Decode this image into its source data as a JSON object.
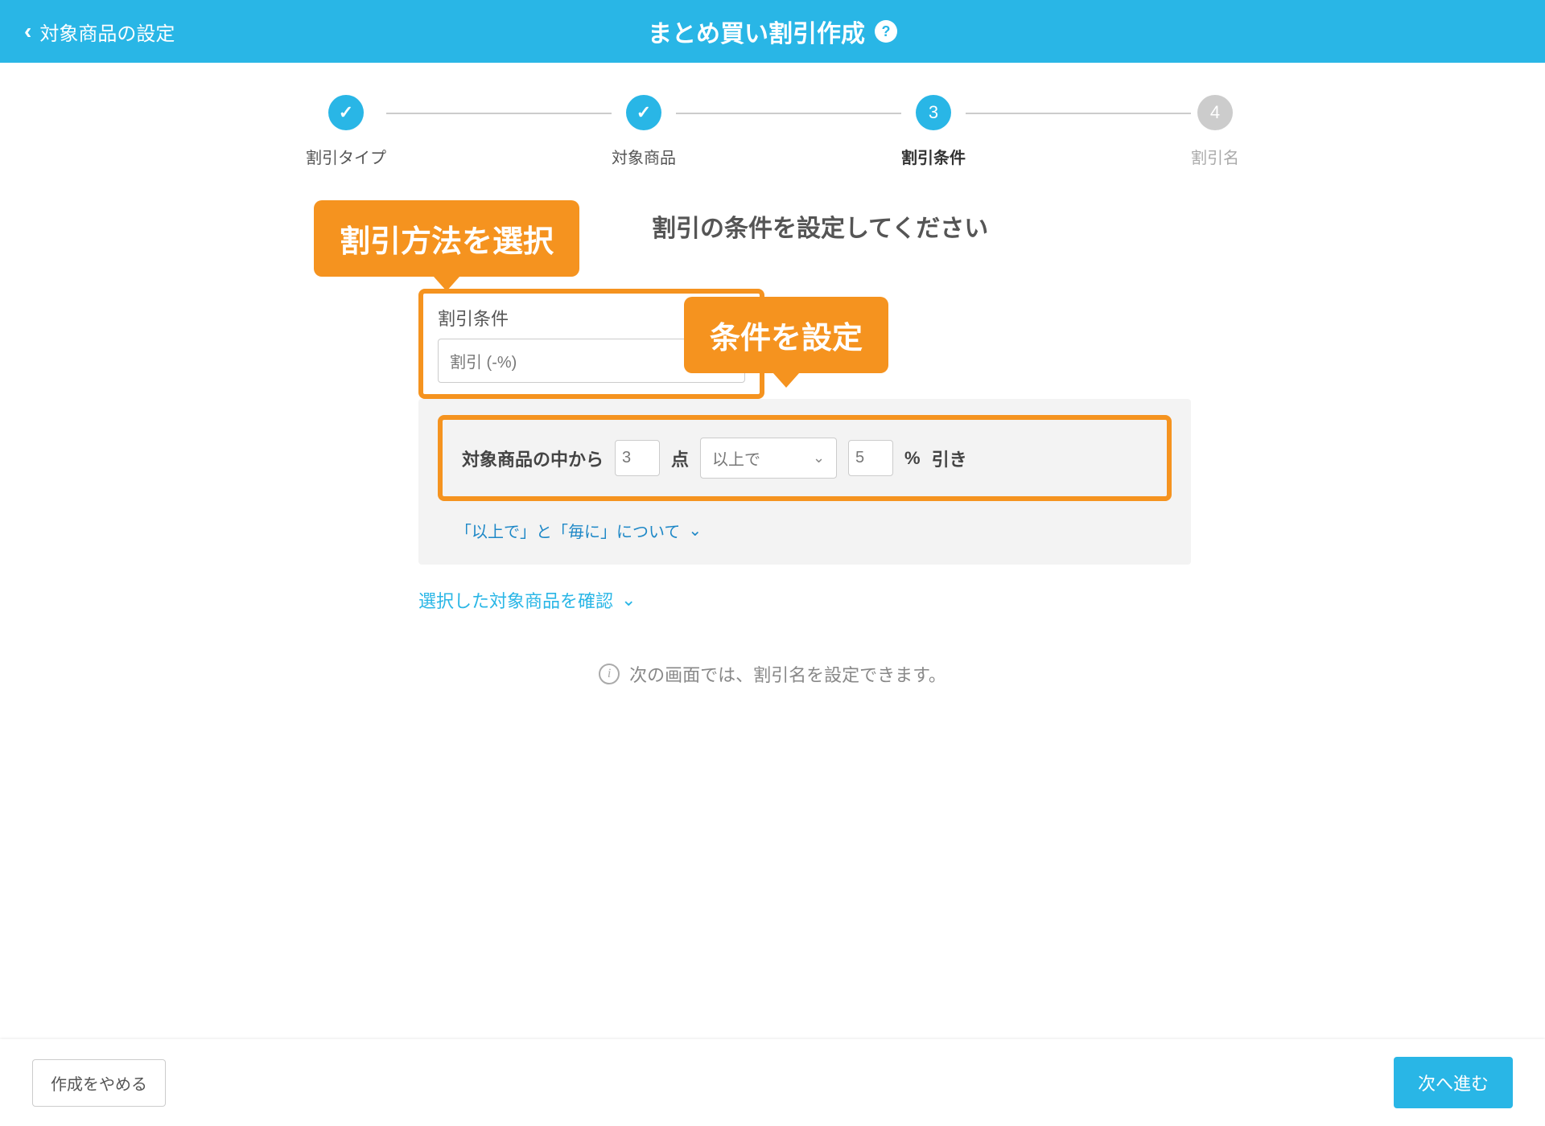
{
  "header": {
    "back_label": "対象商品の設定",
    "title": "まとめ買い割引作成"
  },
  "stepper": {
    "steps": [
      {
        "label": "割引タイプ",
        "state": "done"
      },
      {
        "label": "対象商品",
        "state": "done"
      },
      {
        "label": "割引条件",
        "state": "active",
        "num": "3"
      },
      {
        "label": "割引名",
        "state": "pending",
        "num": "4"
      }
    ]
  },
  "callouts": {
    "select_method": "割引方法を選択",
    "set_condition": "条件を設定"
  },
  "section": {
    "title": "割引の条件を設定してください"
  },
  "discount_condition": {
    "label": "割引条件",
    "selected": "割引 (-%)"
  },
  "condition_row": {
    "prefix": "対象商品の中から",
    "qty_value": "3",
    "qty_unit": "点",
    "comparator": "以上で",
    "pct_value": "5",
    "pct_unit": "%",
    "suffix": "引き"
  },
  "links": {
    "about_comparators": "「以上で」と「毎に」について",
    "check_selected": "選択した対象商品を確認"
  },
  "info": {
    "text": "次の画面では、割引名を設定できます。"
  },
  "footer": {
    "cancel": "作成をやめる",
    "next": "次へ進む"
  }
}
